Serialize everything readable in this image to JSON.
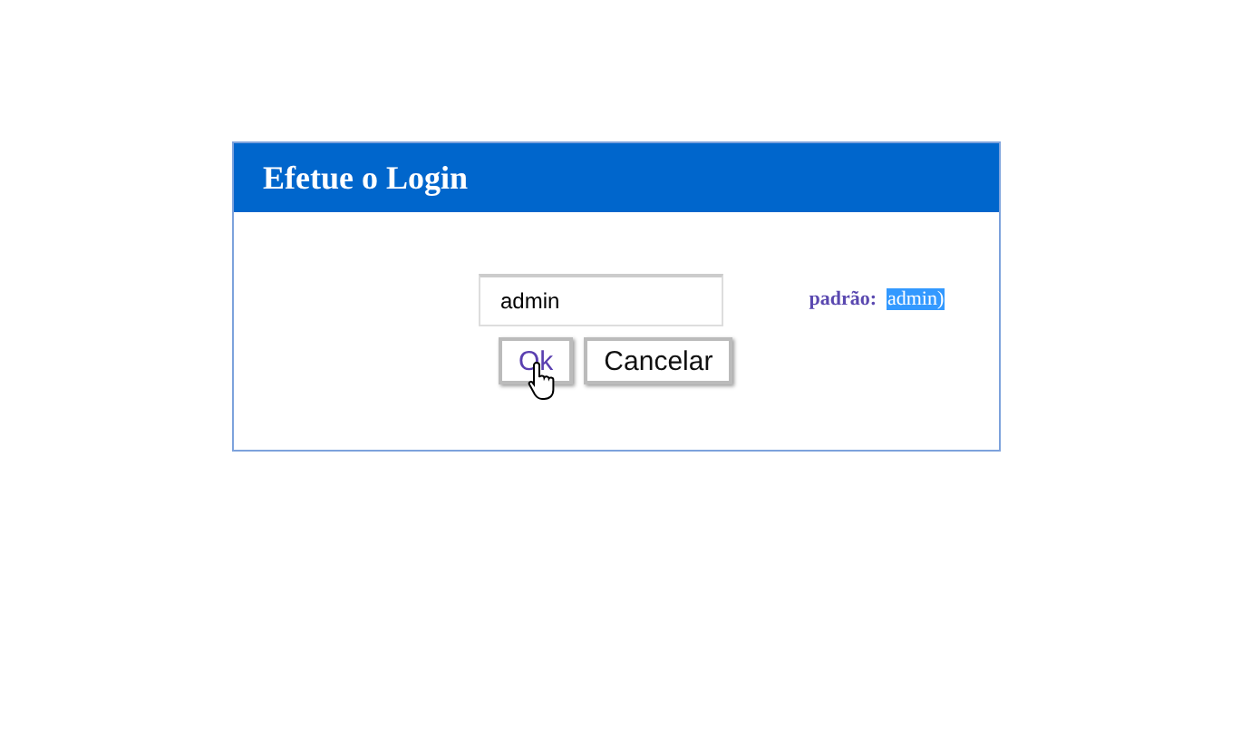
{
  "dialog": {
    "title": "Efetue o Login"
  },
  "login_field": {
    "value": "admin"
  },
  "hint": {
    "label": "padrão:",
    "value": "admin)",
    "highlighted": true
  },
  "buttons": [
    {
      "label": "Ok",
      "hovered": true
    },
    {
      "label": "Cancelar",
      "hovered": false
    }
  ]
}
